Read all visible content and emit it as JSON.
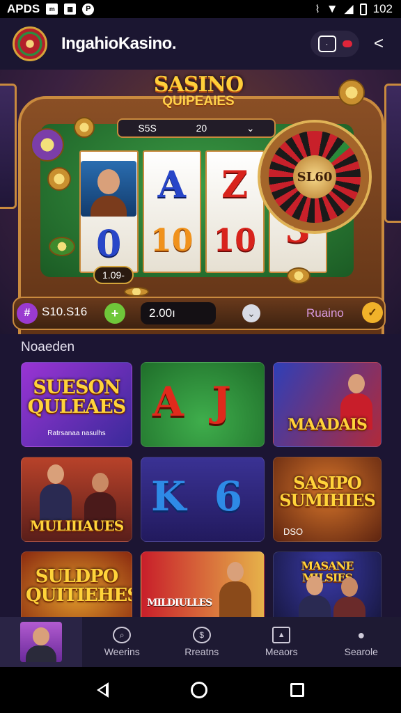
{
  "status_bar": {
    "left_text": "APDS",
    "left_icons": [
      "mail-icon",
      "image-icon",
      "p-icon"
    ],
    "right_icons": [
      "vibrate-icon",
      "wifi-icon",
      "signal-icon",
      "battery-icon"
    ],
    "time": "102"
  },
  "app_bar": {
    "title": "IngahioKasino.",
    "actions": [
      "chat-icon",
      "notification-dot",
      "share-icon"
    ]
  },
  "banner": {
    "logo_line1": "SASINO",
    "logo_line2": "QUIPEAIES",
    "bet_bar": {
      "value_left": "S5S",
      "value_right": "20",
      "dropdown_icon": "chevron-down-icon"
    },
    "reels": [
      {
        "symbols": [
          "portrait",
          "0"
        ]
      },
      {
        "symbols": [
          "A",
          "10"
        ]
      },
      {
        "symbols": [
          "Z",
          "10"
        ]
      },
      {
        "symbols": [
          "",
          "3"
        ]
      }
    ],
    "wheel_label": "SL60",
    "chip_value": "1.09-"
  },
  "controls": {
    "balance": "S10.S16",
    "plus_label": "+",
    "bet_value": "2.00ı",
    "label": "Ruaino",
    "ok_label": "✓"
  },
  "section_title": "Noaeden",
  "tiles": [
    {
      "title": "SUESON QULEAES",
      "subtitle": "Ratrsanaa nasulhs"
    },
    {
      "title": "A  J",
      "subtitle": ""
    },
    {
      "title": "MAADAIS",
      "subtitle": ""
    },
    {
      "title": "MULIIIAUES",
      "subtitle": ""
    },
    {
      "title": "K  6",
      "subtitle": ""
    },
    {
      "title": "SASIPO SUMIHIES",
      "subtitle": "DSO"
    },
    {
      "title": "SULDPO QUITIEHES",
      "subtitle": ""
    },
    {
      "title": "MILDIULLES",
      "subtitle": ""
    },
    {
      "title": "MASANE MILSIES",
      "subtitle": ""
    }
  ],
  "bottom_nav": {
    "items": [
      {
        "label": "Weerins",
        "icon": "search-icon"
      },
      {
        "label": "Rreatns",
        "icon": "coin-icon"
      },
      {
        "label": "Meaors",
        "icon": "image-icon"
      },
      {
        "label": "Searole",
        "icon": "profile-icon"
      }
    ]
  },
  "colors": {
    "background": "#1c1533",
    "accent_gold": "#ffd33a",
    "accent_purple": "#9a3ad0",
    "accent_green": "#6fc73a"
  }
}
